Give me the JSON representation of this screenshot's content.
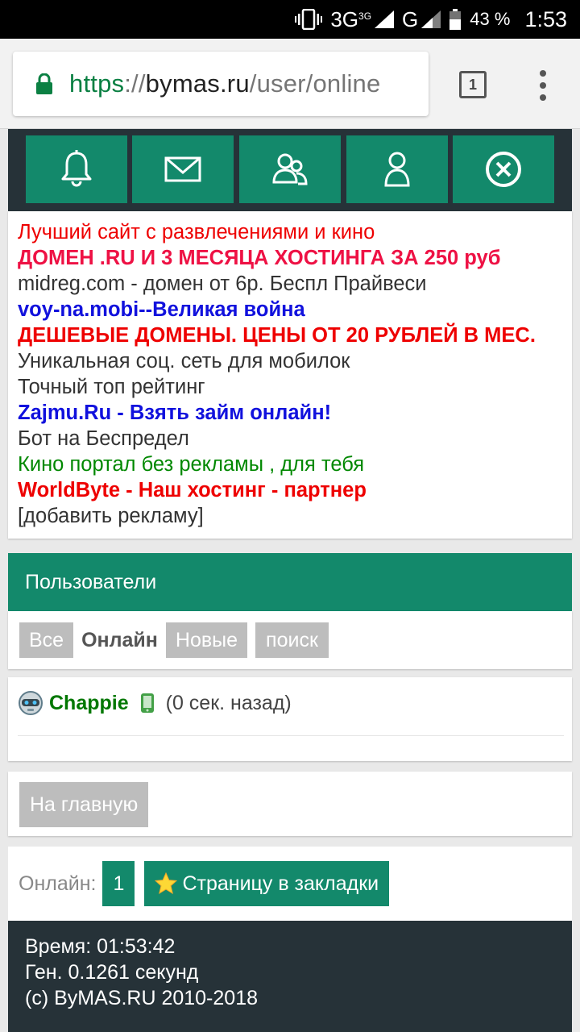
{
  "status_bar": {
    "network_1": "3G",
    "network_1_small": "3G",
    "network_2": "G",
    "battery": "43 %",
    "time": "1:53"
  },
  "browser": {
    "url_scheme": "https",
    "url_sep": "://",
    "url_host": "bymas.ru",
    "url_path": "/user/online",
    "tab_count": "1"
  },
  "icon_bar": [
    {
      "name": "bell-icon"
    },
    {
      "name": "mail-icon"
    },
    {
      "name": "users-icon"
    },
    {
      "name": "user-icon"
    },
    {
      "name": "close-icon"
    }
  ],
  "ads": [
    {
      "text": "Лучший сайт с развлечениями и кино",
      "color": "#ee0000",
      "bold": false
    },
    {
      "text": "ДОМЕН .RU И 3 МЕСЯЦА ХОСТИНГА ЗА 250 руб",
      "color": "#ee1144",
      "bold": true
    },
    {
      "text": "midreg.com - домен от 6р. Беспл Прайвеси",
      "color": "#333333",
      "bold": false
    },
    {
      "text": "voy-na.mobi--Великая война",
      "color": "#1111dd",
      "bold": true
    },
    {
      "text": "ДЕШЕВЫЕ ДОМЕНЫ. ЦЕНЫ ОТ 20 РУБЛЕЙ В МЕС.",
      "color": "#ee0000",
      "bold": true
    },
    {
      "text": "Уникальная соц. сеть для мобилок",
      "color": "#333333",
      "bold": false
    },
    {
      "text": "Точный топ рейтинг",
      "color": "#333333",
      "bold": false
    },
    {
      "text": "Zajmu.Ru - Взять займ онлайн!",
      "color": "#1111dd",
      "bold": true
    },
    {
      "text": "Бот на Беспредел",
      "color": "#333333",
      "bold": false
    },
    {
      "text": "Кино портал без рекламы , для тебя",
      "color": "#008800",
      "bold": false
    },
    {
      "text": "WorldByte - Наш хостинг - партнер",
      "color": "#ee0000",
      "bold": true
    },
    {
      "text": "[добавить рекламу]",
      "color": "#333333",
      "bold": false
    }
  ],
  "section": {
    "title": "Пользователи"
  },
  "tabs": {
    "all": "Все",
    "online": "Онлайн",
    "new": "Новые",
    "search": "поиск"
  },
  "user": {
    "name": "Chappie",
    "time": "(0 сек. назад)"
  },
  "home_button": "На главную",
  "online": {
    "label": "Онлайн:",
    "count": "1",
    "bookmark": "Страницу в закладки"
  },
  "footer": {
    "time": "Время: 01:53:42",
    "gen": "Ген. 0.1261 секунд",
    "copyright": "(c) ByMAS.RU 2010-2018"
  },
  "colors": {
    "accent": "#13896b",
    "dark": "#263238"
  }
}
